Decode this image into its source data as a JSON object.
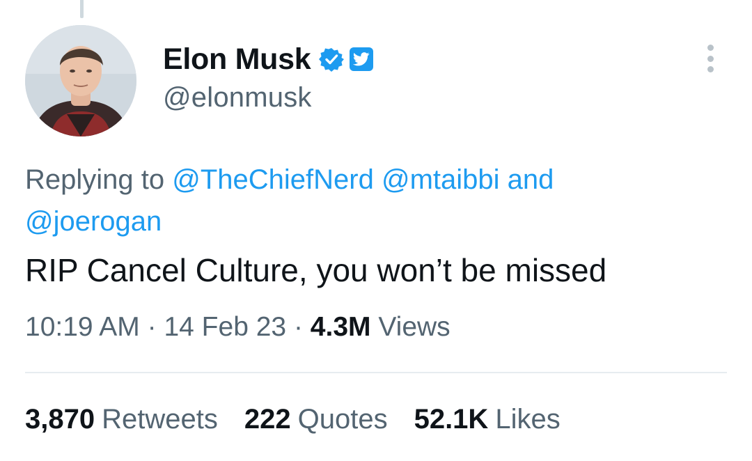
{
  "author": {
    "display_name": "Elon Musk",
    "handle": "@elonmusk",
    "verified_icon": "verified-badge-icon",
    "affiliate_icon": "twitter-bird-icon"
  },
  "reply": {
    "prefix": "Replying to",
    "mentions": [
      "@TheChiefNerd",
      "@mtaibbi",
      "@joerogan"
    ],
    "conjunction": "and"
  },
  "tweet": {
    "text": "RIP Cancel Culture, you won’t be missed"
  },
  "meta": {
    "time": "10:19 AM",
    "separator": "·",
    "date": "14 Feb 23",
    "views_count": "4.3M",
    "views_label": "Views"
  },
  "stats": [
    {
      "count": "3,870",
      "label": "Retweets"
    },
    {
      "count": "222",
      "label": "Quotes"
    },
    {
      "count": "52.1K",
      "label": "Likes"
    }
  ],
  "colors": {
    "accent": "#1d9bf0",
    "text": "#0f1419",
    "secondary": "#536471",
    "divider": "#e6ecf0"
  }
}
